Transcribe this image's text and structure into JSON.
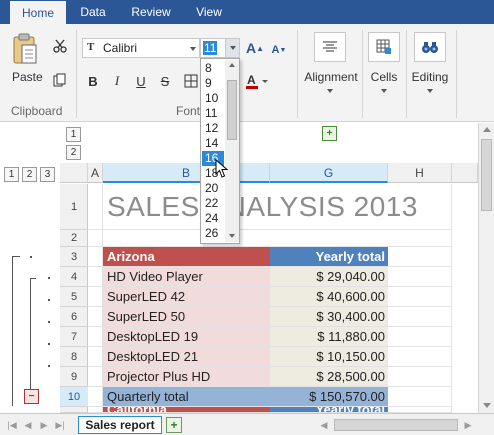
{
  "tabs": [
    {
      "label": "Home",
      "active": true
    },
    {
      "label": "Data",
      "active": false
    },
    {
      "label": "Review",
      "active": false
    },
    {
      "label": "View",
      "active": false
    }
  ],
  "ribbon": {
    "clipboard": {
      "paste_label": "Paste",
      "group_label": "Clipboard"
    },
    "font": {
      "font_name": "Calibri",
      "font_size": "11",
      "group_label": "Font",
      "bold": "B",
      "italic": "I",
      "underline": "U",
      "strike": "S",
      "grow": "A",
      "shrink": "A"
    },
    "alignment_label": "Alignment",
    "cells_label": "Cells",
    "editing_label": "Editing"
  },
  "size_dropdown": {
    "items": [
      "8",
      "9",
      "10",
      "11",
      "12",
      "14",
      "16",
      "18",
      "20",
      "22",
      "24",
      "26"
    ],
    "selected": "16"
  },
  "outline": {
    "col_levels": [
      "1",
      "2"
    ],
    "row_levels": [
      "1",
      "2",
      "3"
    ],
    "collapse_symbol": "−",
    "expand_symbol": "+"
  },
  "columns": [
    "A",
    "B",
    "G",
    "H"
  ],
  "rows": [
    {
      "num": "1",
      "cells": {
        "B": "SALES ANALYSIS 2013"
      }
    },
    {
      "num": "2",
      "cells": {}
    },
    {
      "num": "3",
      "cells": {
        "B": "Arizona",
        "G": "Yearly total"
      }
    },
    {
      "num": "4",
      "cells": {
        "B": "HD Video Player",
        "G": "$ 29,040.00"
      }
    },
    {
      "num": "5",
      "cells": {
        "B": "SuperLED 42",
        "G": "$ 40,600.00"
      }
    },
    {
      "num": "6",
      "cells": {
        "B": "SuperLED 50",
        "G": "$ 30,400.00"
      }
    },
    {
      "num": "7",
      "cells": {
        "B": "DesktopLED 19",
        "G": "$ 11,880.00"
      }
    },
    {
      "num": "8",
      "cells": {
        "B": "DesktopLED 21",
        "G": "$ 10,150.00"
      }
    },
    {
      "num": "9",
      "cells": {
        "B": "Projector Plus HD",
        "G": "$ 28,500.00"
      }
    },
    {
      "num": "10",
      "cells": {
        "B": "Quarterly total",
        "G": "$ 150,570.00"
      }
    },
    {
      "num": "",
      "cells": {
        "B": "California",
        "G": "Yearly total"
      }
    }
  ],
  "sheet_tabs": [
    {
      "label": "Sales report",
      "active": true
    }
  ],
  "colors": {
    "tab_bar": "#2b5797",
    "header_red": "#c0504d",
    "header_blue": "#4f81bd",
    "body_pink": "#f2dcdb",
    "body_beige": "#eeece1",
    "total_blue": "#95b3d7",
    "total_row_pink": "#c0504d"
  }
}
